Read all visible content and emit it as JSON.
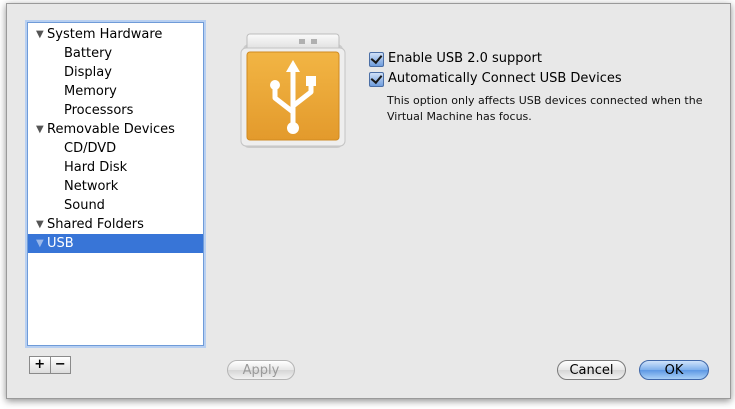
{
  "sidebar": {
    "groups": [
      {
        "label": "System Hardware",
        "children": [
          "Battery",
          "Display",
          "Memory",
          "Processors"
        ]
      },
      {
        "label": "Removable Devices",
        "children": [
          "CD/DVD",
          "Hard Disk",
          "Network",
          "Sound"
        ]
      },
      {
        "label": "Shared Folders",
        "children": []
      },
      {
        "label": "USB",
        "children": [],
        "selected": true
      }
    ],
    "add_label": "+",
    "remove_label": "−"
  },
  "usb": {
    "icon": "usb-icon",
    "enable_usb2_label": "Enable USB 2.0 support",
    "enable_usb2_checked": true,
    "auto_connect_label": "Automatically Connect USB Devices",
    "auto_connect_checked": true,
    "hint": "This option only affects USB devices connected when the Virtual Machine has focus."
  },
  "buttons": {
    "apply": "Apply",
    "cancel": "Cancel",
    "ok": "OK"
  },
  "colors": {
    "selection": "#3875d7",
    "icon_orange": "#e8a234",
    "default_button": "#5d98e4"
  }
}
